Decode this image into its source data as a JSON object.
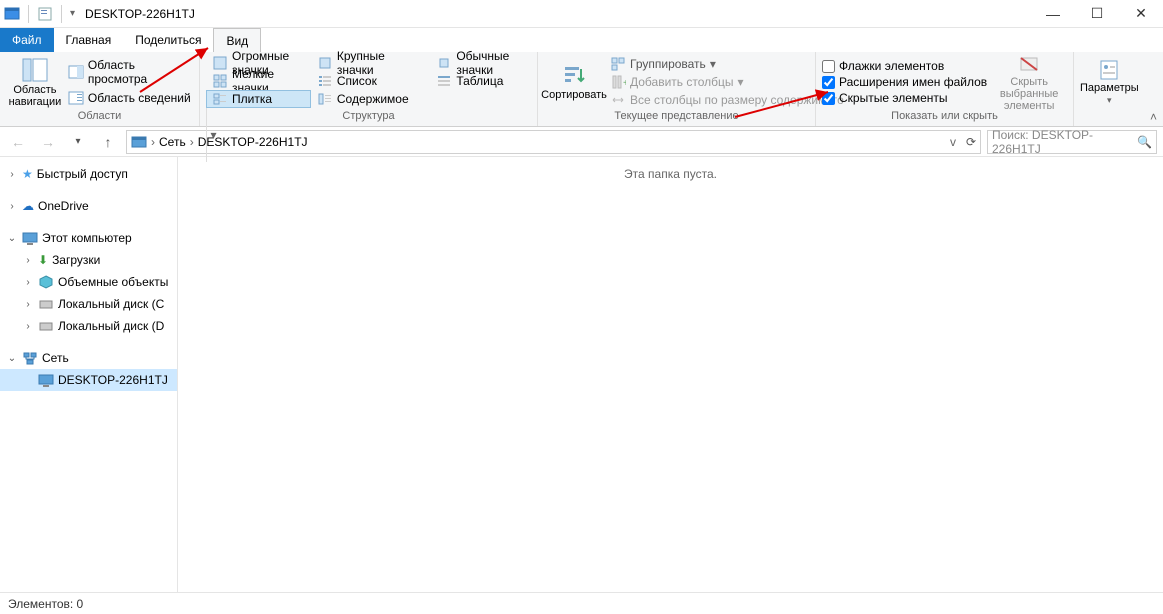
{
  "window_title": "DESKTOP-226H1TJ",
  "tabs": {
    "file": "Файл",
    "home": "Главная",
    "share": "Поделиться",
    "view": "Вид"
  },
  "ribbon": {
    "navpane_btn": "Область навигации",
    "preview_pane": "Область просмотра",
    "details_pane": "Область сведений",
    "group_areas": "Области",
    "layouts": {
      "huge": "Огромные значки",
      "large": "Крупные значки",
      "medium": "Обычные значки",
      "small": "Мелкие значки",
      "list": "Список",
      "table": "Таблица",
      "tiles": "Плитка",
      "content": "Содержимое"
    },
    "group_layout": "Структура",
    "sort": "Сортировать",
    "group_by": "Группировать",
    "add_columns": "Добавить столбцы",
    "size_columns": "Все столбцы по размеру содержимого",
    "group_current": "Текущее представление",
    "item_checkboxes": "Флажки элементов",
    "file_ext": "Расширения имен файлов",
    "hidden_items": "Скрытые элементы",
    "hide_selected": "Скрыть выбранные элементы",
    "group_show": "Показать или скрыть",
    "options": "Параметры"
  },
  "breadcrumb": {
    "network": "Сеть",
    "node": "DESKTOP-226H1TJ"
  },
  "search_placeholder": "Поиск: DESKTOP-226H1TJ",
  "tree": {
    "quick": "Быстрый доступ",
    "onedrive": "OneDrive",
    "thispc": "Этот компьютер",
    "downloads": "Загрузки",
    "volumes": "Объемные объекты",
    "localc": "Локальный диск (C",
    "locald": "Локальный диск (D",
    "network": "Сеть",
    "node": "DESKTOP-226H1TJ"
  },
  "empty_folder": "Эта папка пуста.",
  "status": "Элементов: 0"
}
